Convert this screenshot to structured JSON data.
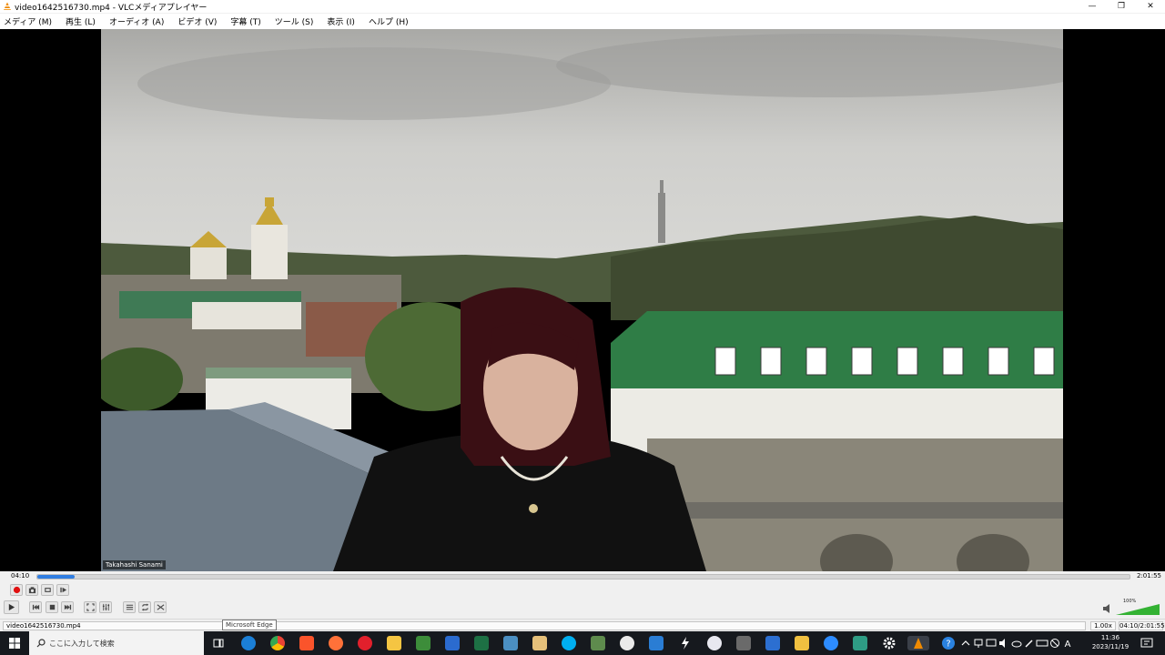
{
  "window": {
    "title": "video1642516730.mp4 - VLCメディアプレイヤー",
    "controls": {
      "minimize": "—",
      "restore": "❐",
      "close": "✕"
    }
  },
  "menu": [
    {
      "label": "メディア (M)"
    },
    {
      "label": "再生 (L)"
    },
    {
      "label": "オーディオ (A)"
    },
    {
      "label": "ビデオ (V)"
    },
    {
      "label": "字幕 (T)"
    },
    {
      "label": "ツール (S)"
    },
    {
      "label": "表示 (I)"
    },
    {
      "label": "ヘルプ (H)"
    }
  ],
  "video": {
    "participant_name": "Takahashi Sanami"
  },
  "playback": {
    "elapsed": "04:10",
    "total": "2:01:55",
    "progress_fraction": 0.034
  },
  "volume": {
    "level_label": "100%",
    "level_fraction": 1.0
  },
  "status": {
    "filename": "video1642516730.mp4",
    "speed": "1.00x",
    "time": "04:10/2:01:55"
  },
  "tooltip": {
    "text": "Microsoft Edge"
  },
  "taskbar": {
    "search_placeholder": "ここに入力して検索",
    "clock_time": "11:36",
    "clock_date": "2023/11/19"
  },
  "colors": {
    "accent": "#2f7de1",
    "record": "#e01010",
    "taskbar_bg": "#16191e"
  }
}
